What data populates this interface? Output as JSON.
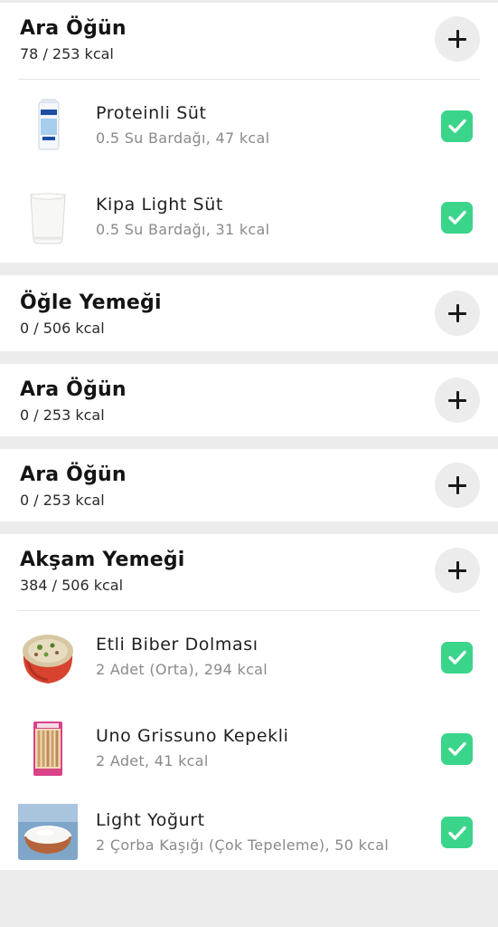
{
  "meals": [
    {
      "title": "Ara Öğün",
      "kcal": "78 / 253 kcal",
      "foods": [
        {
          "name": "Proteinli Süt",
          "desc": "0.5 Su Bardağı, 47 kcal",
          "checked": true
        },
        {
          "name": "Kipa Light Süt",
          "desc": "0.5 Su Bardağı, 31 kcal",
          "checked": true
        }
      ]
    },
    {
      "title": "Öğle Yemeği",
      "kcal": "0 / 506 kcal",
      "foods": []
    },
    {
      "title": "Ara Öğün",
      "kcal": "0 / 253 kcal",
      "foods": []
    },
    {
      "title": "Ara Öğün",
      "kcal": "0 / 253 kcal",
      "foods": []
    },
    {
      "title": "Akşam Yemeği",
      "kcal": "384 / 506 kcal",
      "foods": [
        {
          "name": "Etli Biber Dolması",
          "desc": "2 Adet (Orta), 294 kcal",
          "checked": true
        },
        {
          "name": "Uno Grissuno Kepekli",
          "desc": "2 Adet, 41 kcal",
          "checked": true
        },
        {
          "name": "Light Yoğurt",
          "desc": "2 Çorba Kaşığı (Çok Tepeleme), 50 kcal",
          "checked": true
        }
      ]
    }
  ],
  "icons": {
    "add": "plus-icon",
    "check": "checkmark-icon"
  },
  "colors": {
    "check_green": "#3ad58a",
    "add_button_bg": "#ececec",
    "page_bg": "#ececec",
    "muted_text": "#8a8a8a"
  }
}
